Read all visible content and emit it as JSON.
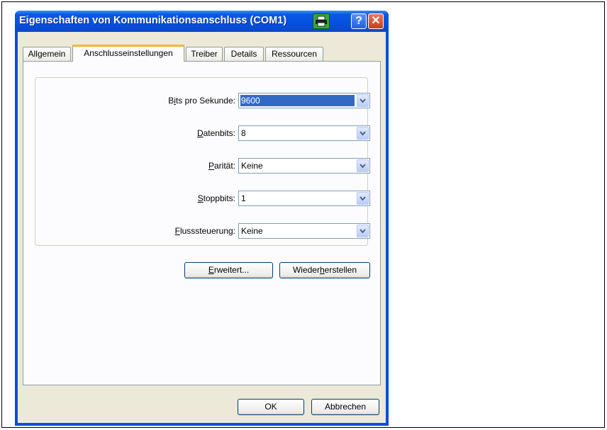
{
  "window": {
    "title": "Eigenschaften von Kommunikationsanschluss (COM1)"
  },
  "tabs": [
    {
      "label": "Allgemein"
    },
    {
      "label": "Anschlusseinstellungen"
    },
    {
      "label": "Treiber"
    },
    {
      "label": "Details"
    },
    {
      "label": "Ressourcen"
    }
  ],
  "settings": {
    "bits": {
      "label_pre": "B",
      "label_u": "i",
      "label_post": "ts pro Sekunde:",
      "value": "9600"
    },
    "data": {
      "label_pre": "",
      "label_u": "D",
      "label_post": "atenbits:",
      "value": "8"
    },
    "parity": {
      "label_pre": "",
      "label_u": "P",
      "label_post": "arität:",
      "value": "Keine"
    },
    "stop": {
      "label_pre": "",
      "label_u": "S",
      "label_post": "toppbits:",
      "value": "1"
    },
    "flow": {
      "label_pre": "",
      "label_u": "F",
      "label_post": "lusssteuerung:",
      "value": "Keine"
    }
  },
  "buttons": {
    "advanced": {
      "pre": "",
      "u": "E",
      "post": "rweitert..."
    },
    "restore": {
      "pre": "Wieder",
      "u": "h",
      "post": "erstellen"
    },
    "ok": "OK",
    "cancel": "Abbrechen"
  },
  "icons": {
    "help": "?",
    "close": "✕"
  }
}
